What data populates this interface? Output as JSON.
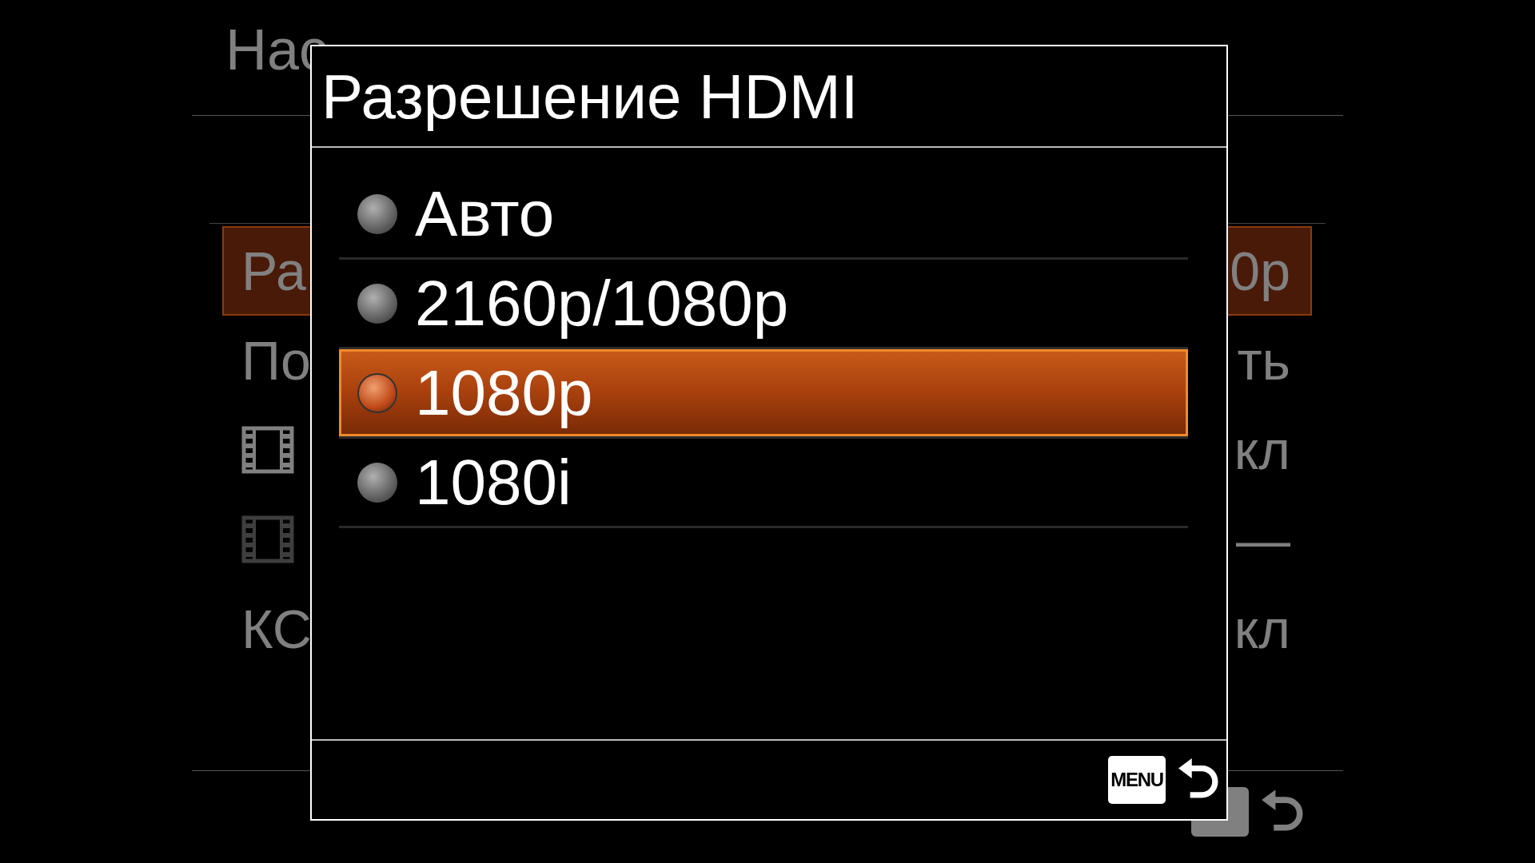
{
  "background": {
    "title": "Нас",
    "rows": [
      {
        "kind": "text",
        "left": "Ра",
        "right": "0p",
        "selected": true
      },
      {
        "kind": "text",
        "left": "По",
        "right": "ть",
        "selected": false
      },
      {
        "kind": "film",
        "right": "кл",
        "selected": false,
        "disabled": false
      },
      {
        "kind": "film",
        "right": "—",
        "selected": false,
        "disabled": true
      },
      {
        "kind": "text",
        "left": "КС",
        "right": "кл",
        "selected": false
      }
    ]
  },
  "dialog": {
    "title": "Разрешение HDMI",
    "options": [
      {
        "label": "Авто",
        "selected": false
      },
      {
        "label": "2160p/1080p",
        "selected": false
      },
      {
        "label": "1080p",
        "selected": true
      },
      {
        "label": "1080i",
        "selected": false
      }
    ],
    "menu_key": "MENU"
  }
}
